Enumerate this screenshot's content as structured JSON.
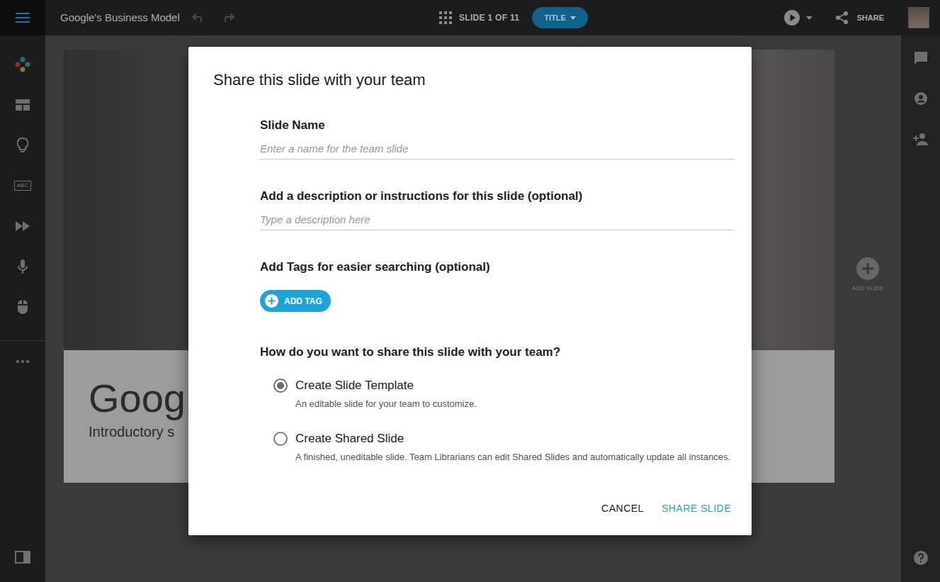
{
  "document": {
    "title": "Google's Business Model"
  },
  "toolbar": {
    "undo": {
      "disabled": true
    },
    "redo": {
      "disabled": true
    },
    "slide_counter": "SLIDE 1 OF 11",
    "layout_pill": "TITLE",
    "share": "SHARE"
  },
  "left_sidebar": {
    "abc_label": "ABC"
  },
  "slide": {
    "title": "Goog",
    "subtitle": "Introductory s"
  },
  "add_slide": {
    "label": "ADD SLIDE"
  },
  "dialog": {
    "title": "Share this slide with your team",
    "fields": [
      {
        "label": "Slide Name",
        "placeholder": "Enter a name for the team slide"
      },
      {
        "label": "Add a description or instructions for this slide (optional)",
        "placeholder": "Type a description here"
      }
    ],
    "tags": {
      "label": "Add Tags for easier searching (optional)",
      "button": "ADD TAG"
    },
    "share_mode": {
      "question": "How do you want to share this slide with your team?",
      "options": [
        {
          "label": "Create Slide Template",
          "description": "An editable slide for your team to customize.",
          "selected": true
        },
        {
          "label": "Create Shared Slide",
          "description": "A finished, uneditable slide. Team Librarians can edit Shared Slides and automatically update all instances.",
          "selected": false
        }
      ]
    },
    "buttons": [
      "CANCEL",
      "SHARE SLIDE"
    ]
  }
}
